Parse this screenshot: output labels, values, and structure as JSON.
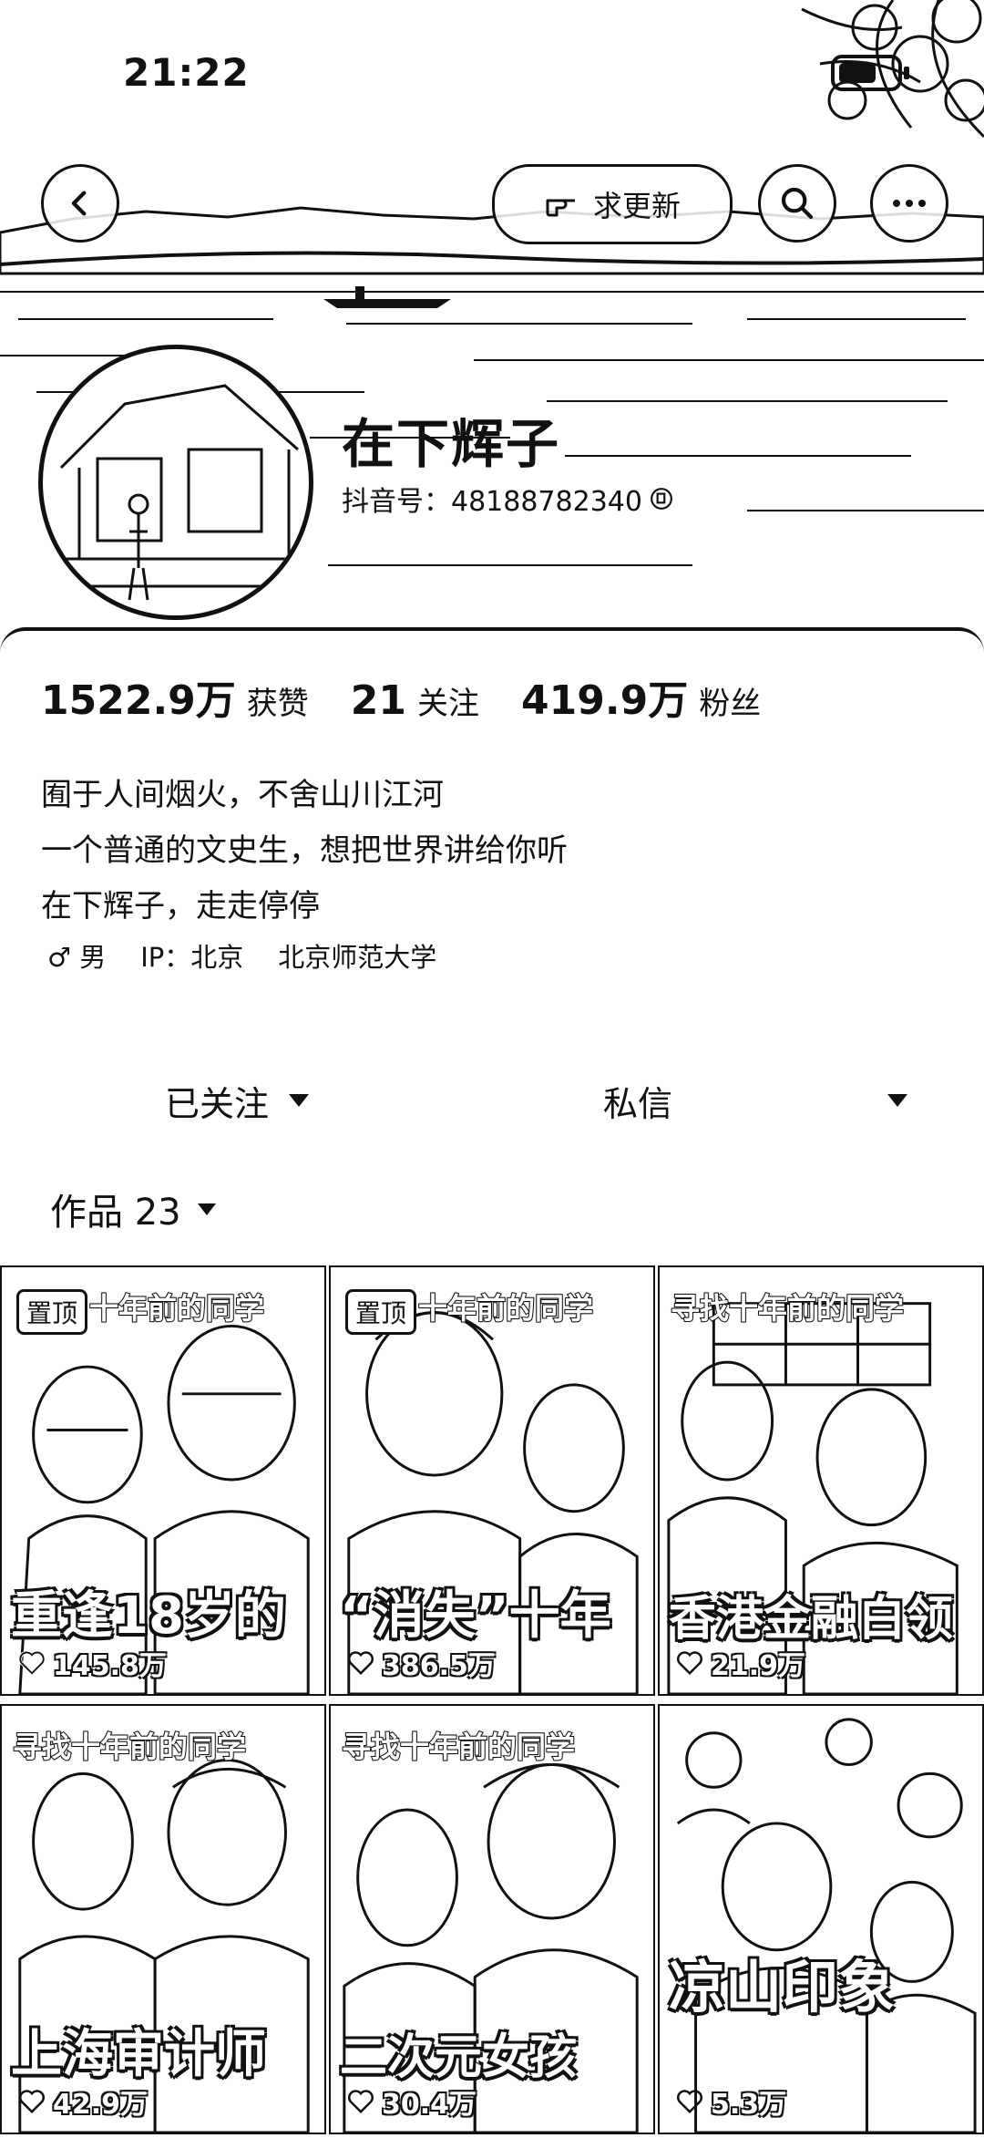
{
  "status": {
    "time": "21:22"
  },
  "header": {
    "request_update_label": "求更新"
  },
  "profile": {
    "nickname": "在下辉子",
    "douyin_id": "抖音号：48188782340"
  },
  "stats": [
    {
      "value": "1522.9万",
      "label": "获赞"
    },
    {
      "value": "21",
      "label": "关注"
    },
    {
      "value": "419.9万",
      "label": "粉丝"
    }
  ],
  "bio": [
    "囿于人间烟火，不舍山川江河",
    "一个普通的文史生，想把世界讲给你听",
    "在下辉子，走走停停"
  ],
  "tags": {
    "gender": "♂ 男",
    "ip": "IP：北京",
    "school": "北京师范大学"
  },
  "actions": {
    "follow": "已关注",
    "message": "私信"
  },
  "works_tab": {
    "label": "作品 23"
  },
  "videos": [
    {
      "pin": "置顶",
      "top_text": "十年前的同学",
      "caption": "重逢18岁的",
      "likes": "145.8万"
    },
    {
      "pin": "置顶",
      "top_text": "十年前的同学",
      "caption": "“消失”十年",
      "likes": "386.5万"
    },
    {
      "pin": "",
      "top_text": "寻找十年前的同学",
      "caption": "香港金融白领",
      "likes": "21.9万"
    },
    {
      "pin": "",
      "top_text": "寻找十年前的同学",
      "caption": "上海审计师",
      "likes": "42.9万"
    },
    {
      "pin": "",
      "top_text": "寻找十年前的同学",
      "caption": "二次元女孩",
      "likes": "30.4万"
    },
    {
      "pin": "",
      "top_text": "",
      "caption": "凉山印象",
      "likes": "5.3万"
    }
  ]
}
